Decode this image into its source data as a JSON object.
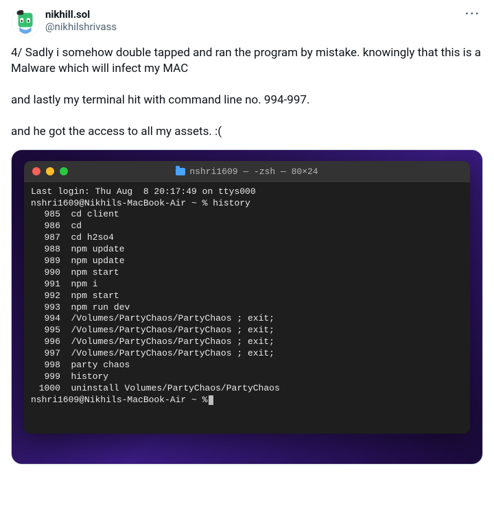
{
  "tweet": {
    "display_name": "nikhill.sol",
    "handle": "@nikhilshrivass",
    "more_glyph": "···",
    "body": "4/ Sadly i somehow double tapped and ran the program by mistake. knowingly that this is a Malware which will infect my MAC\n\nand lastly my terminal hit with command line no. 994-997.\n\nand he got the access to all my assets. :("
  },
  "terminal": {
    "title": "nshri1609 — -zsh — 80×24",
    "last_login": "Last login: Thu Aug  8 20:17:49 on ttys000",
    "prompt_history": "nshri1609@Nikhils-MacBook-Air ~ % history",
    "history": [
      {
        "n": "985",
        "cmd": "cd client"
      },
      {
        "n": "986",
        "cmd": "cd"
      },
      {
        "n": "987",
        "cmd": "cd h2so4"
      },
      {
        "n": "988",
        "cmd": "npm update"
      },
      {
        "n": "989",
        "cmd": "npm update"
      },
      {
        "n": "990",
        "cmd": "npm start"
      },
      {
        "n": "991",
        "cmd": "npm i"
      },
      {
        "n": "992",
        "cmd": "npm start"
      },
      {
        "n": "993",
        "cmd": "npm run dev"
      },
      {
        "n": "994",
        "cmd": "/Volumes/PartyChaos/PartyChaos ; exit;"
      },
      {
        "n": "995",
        "cmd": "/Volumes/PartyChaos/PartyChaos ; exit;"
      },
      {
        "n": "996",
        "cmd": "/Volumes/PartyChaos/PartyChaos ; exit;"
      },
      {
        "n": "997",
        "cmd": "/Volumes/PartyChaos/PartyChaos ; exit;"
      },
      {
        "n": "998",
        "cmd": "party chaos"
      },
      {
        "n": "999",
        "cmd": "history"
      },
      {
        "n": "1000",
        "cmd": "uninstall Volumes/PartyChaos/PartyChaos"
      }
    ],
    "prompt_current": "nshri1609@Nikhils-MacBook-Air ~ % "
  }
}
